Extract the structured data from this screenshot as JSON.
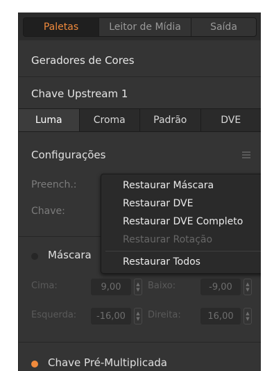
{
  "top_tabs": [
    "Paletas",
    "Leitor de Mídia",
    "Saída"
  ],
  "sections": {
    "color_generators": "Geradores de Cores",
    "upstream_key": "Chave Upstream 1"
  },
  "sub_tabs": [
    "Luma",
    "Croma",
    "Padrão",
    "DVE"
  ],
  "settings": {
    "title": "Configurações",
    "fill_label": "Preench.:",
    "key_label": "Chave:"
  },
  "context_menu": {
    "items": [
      {
        "label": "Restaurar Máscara",
        "enabled": true
      },
      {
        "label": "Restaurar DVE",
        "enabled": true
      },
      {
        "label": "Restaurar DVE Completo",
        "enabled": true
      },
      {
        "label": "Restaurar Rotação",
        "enabled": false
      },
      {
        "label": "Restaurar Todos",
        "enabled": true
      }
    ]
  },
  "mask": {
    "label": "Máscara",
    "top_label": "Cima:",
    "top_value": "9,00",
    "bottom_label": "Baixo:",
    "bottom_value": "-9,00",
    "left_label": "Esquerda:",
    "left_value": "-16,00",
    "right_label": "Direita:",
    "right_value": "16,00"
  },
  "premultiplied": {
    "label": "Chave Pré-Multiplicada"
  },
  "colors": {
    "accent": "#f08a3c",
    "panel": "#343434"
  }
}
